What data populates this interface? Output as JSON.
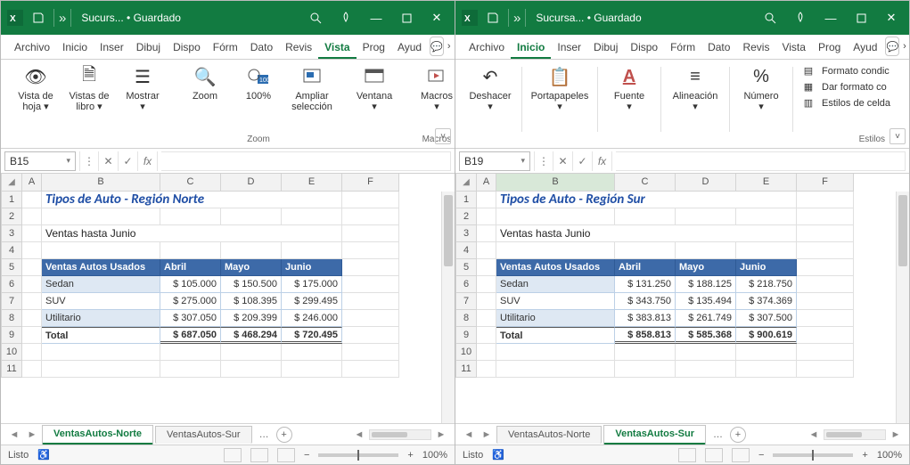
{
  "left": {
    "titlebar": {
      "doc": "Sucurs...",
      "saved": "• Guardado"
    },
    "tabs": [
      "Archivo",
      "Inicio",
      "Inser",
      "Dibuj",
      "Dispo",
      "Fórm",
      "Dato",
      "Revis",
      "Vista",
      "Prog",
      "Ayud"
    ],
    "active_tab": "Vista",
    "ribbon": {
      "groups": {
        "g1": [
          {
            "label": "Vista de\nhoja ▾"
          },
          {
            "label": "Vistas de\nlibro ▾"
          },
          {
            "label": "Mostrar\n▾"
          }
        ],
        "zoom_group": "Zoom",
        "zoom": [
          {
            "label": "Zoom"
          },
          {
            "label": "100%"
          },
          {
            "label": "Ampliar\nselección"
          }
        ],
        "ventana": "Ventana\n▾",
        "macros_group": "Macros",
        "macros": "Macros\n▾"
      }
    },
    "namebox": "B15",
    "fx": "fx",
    "sheet": {
      "title": "Tipos de Auto - Región Norte",
      "subtitle": "Ventas hasta Junio",
      "hdr": [
        "Ventas Autos Usados",
        "Abril",
        "Mayo",
        "Junio"
      ],
      "rows": [
        {
          "l": "Sedan",
          "c": "$ 105.000",
          "d": "$ 150.500",
          "e": "$ 175.000"
        },
        {
          "l": "SUV",
          "c": "$ 275.000",
          "d": "$ 108.395",
          "e": "$ 299.495"
        },
        {
          "l": "Utilitario",
          "c": "$ 307.050",
          "d": "$ 209.399",
          "e": "$ 246.000"
        }
      ],
      "total": {
        "l": "Total",
        "c": "$ 687.050",
        "d": "$ 468.294",
        "e": "$ 720.495"
      }
    },
    "tabs_sheet": {
      "active": "VentasAutos-Norte",
      "other": "VentasAutos-Sur"
    },
    "status": {
      "ready": "Listo",
      "zoom": "100%"
    }
  },
  "right": {
    "titlebar": {
      "doc": "Sucursa...",
      "saved": "• Guardado"
    },
    "tabs": [
      "Archivo",
      "Inicio",
      "Inser",
      "Dibuj",
      "Dispo",
      "Fórm",
      "Dato",
      "Revis",
      "Vista",
      "Prog",
      "Ayud"
    ],
    "active_tab": "Inicio",
    "ribbon": {
      "deshacer": "Deshacer\n▾",
      "porta": "Portapapeles\n▾",
      "fuente": "Fuente\n▾",
      "alinea": "Alineación\n▾",
      "numero": "Número\n▾",
      "estilos_group": "Estilos",
      "estilos": [
        "Formato condic",
        "Dar formato co",
        "Estilos de celda"
      ]
    },
    "namebox": "B19",
    "fx": "fx",
    "sheet": {
      "title": "Tipos de Auto - Región Sur",
      "subtitle": "Ventas hasta Junio",
      "hdr": [
        "Ventas Autos Usados",
        "Abril",
        "Mayo",
        "Junio"
      ],
      "rows": [
        {
          "l": "Sedan",
          "c": "$ 131.250",
          "d": "$ 188.125",
          "e": "$ 218.750"
        },
        {
          "l": "SUV",
          "c": "$ 343.750",
          "d": "$ 135.494",
          "e": "$ 374.369"
        },
        {
          "l": "Utilitario",
          "c": "$ 383.813",
          "d": "$ 261.749",
          "e": "$ 307.500"
        }
      ],
      "total": {
        "l": "Total",
        "c": "$ 858.813",
        "d": "$ 585.368",
        "e": "$ 900.619"
      }
    },
    "tabs_sheet": {
      "other": "VentasAutos-Norte",
      "active": "VentasAutos-Sur"
    },
    "status": {
      "ready": "Listo",
      "zoom": "100%"
    }
  },
  "cols": [
    "A",
    "B",
    "C",
    "D",
    "E",
    "F"
  ]
}
